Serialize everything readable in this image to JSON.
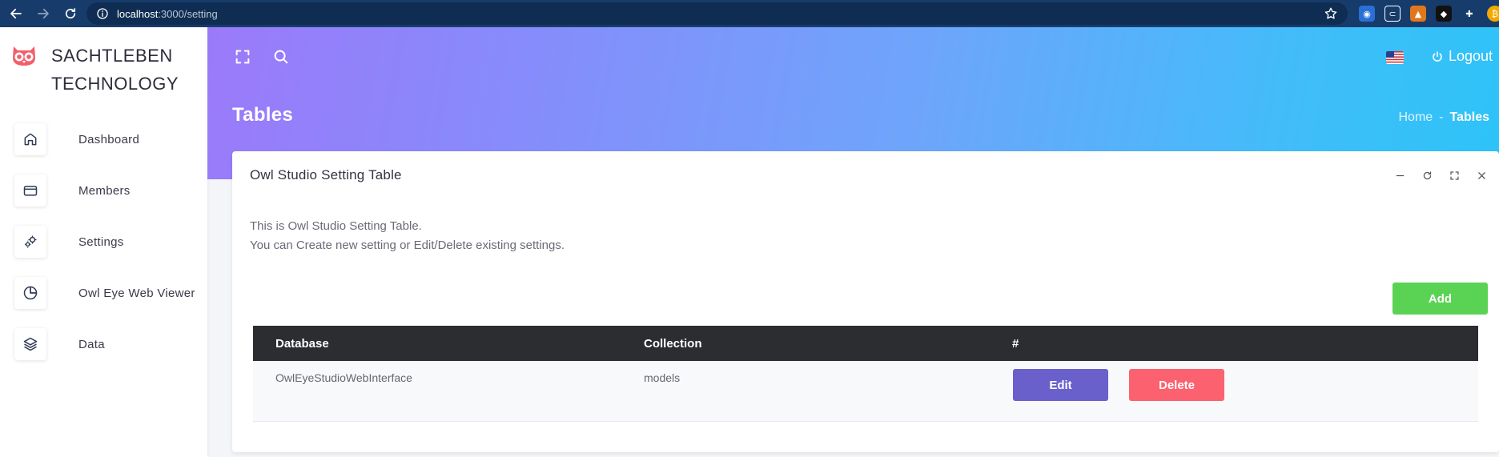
{
  "browser": {
    "url_host": "localhost",
    "url_path": ":3000/setting"
  },
  "brand": {
    "line1": "SACHTLEBEN",
    "line2": "TECHNOLOGY"
  },
  "sidebar": {
    "items": [
      {
        "label": "Dashboard",
        "icon": "home-icon"
      },
      {
        "label": "Members",
        "icon": "card-icon"
      },
      {
        "label": "Settings",
        "icon": "gears-icon"
      },
      {
        "label": "Owl Eye Web Viewer",
        "icon": "pie-chart-icon"
      },
      {
        "label": "Data",
        "icon": "layers-icon"
      }
    ]
  },
  "header": {
    "logout_label": "Logout",
    "page_title": "Tables",
    "breadcrumb": {
      "home": "Home",
      "separator": "-",
      "current": "Tables"
    }
  },
  "card": {
    "title": "Owl Studio Setting Table",
    "desc_line1": "This is Owl Studio Setting Table.",
    "desc_line2": "You can Create new setting or Edit/Delete existing settings.",
    "add_label": "Add"
  },
  "table": {
    "columns": [
      "Database",
      "Collection",
      "#"
    ],
    "rows": [
      {
        "database": "OwlEyeStudioWebInterface",
        "collection": "models",
        "edit_label": "Edit",
        "delete_label": "Delete"
      }
    ]
  },
  "colors": {
    "gradient_start": "#9b7af9",
    "gradient_end": "#2dc3f8",
    "add": "#5ad354",
    "edit": "#6a60cc",
    "delete": "#fc616f",
    "table_header": "#2b2d30"
  }
}
